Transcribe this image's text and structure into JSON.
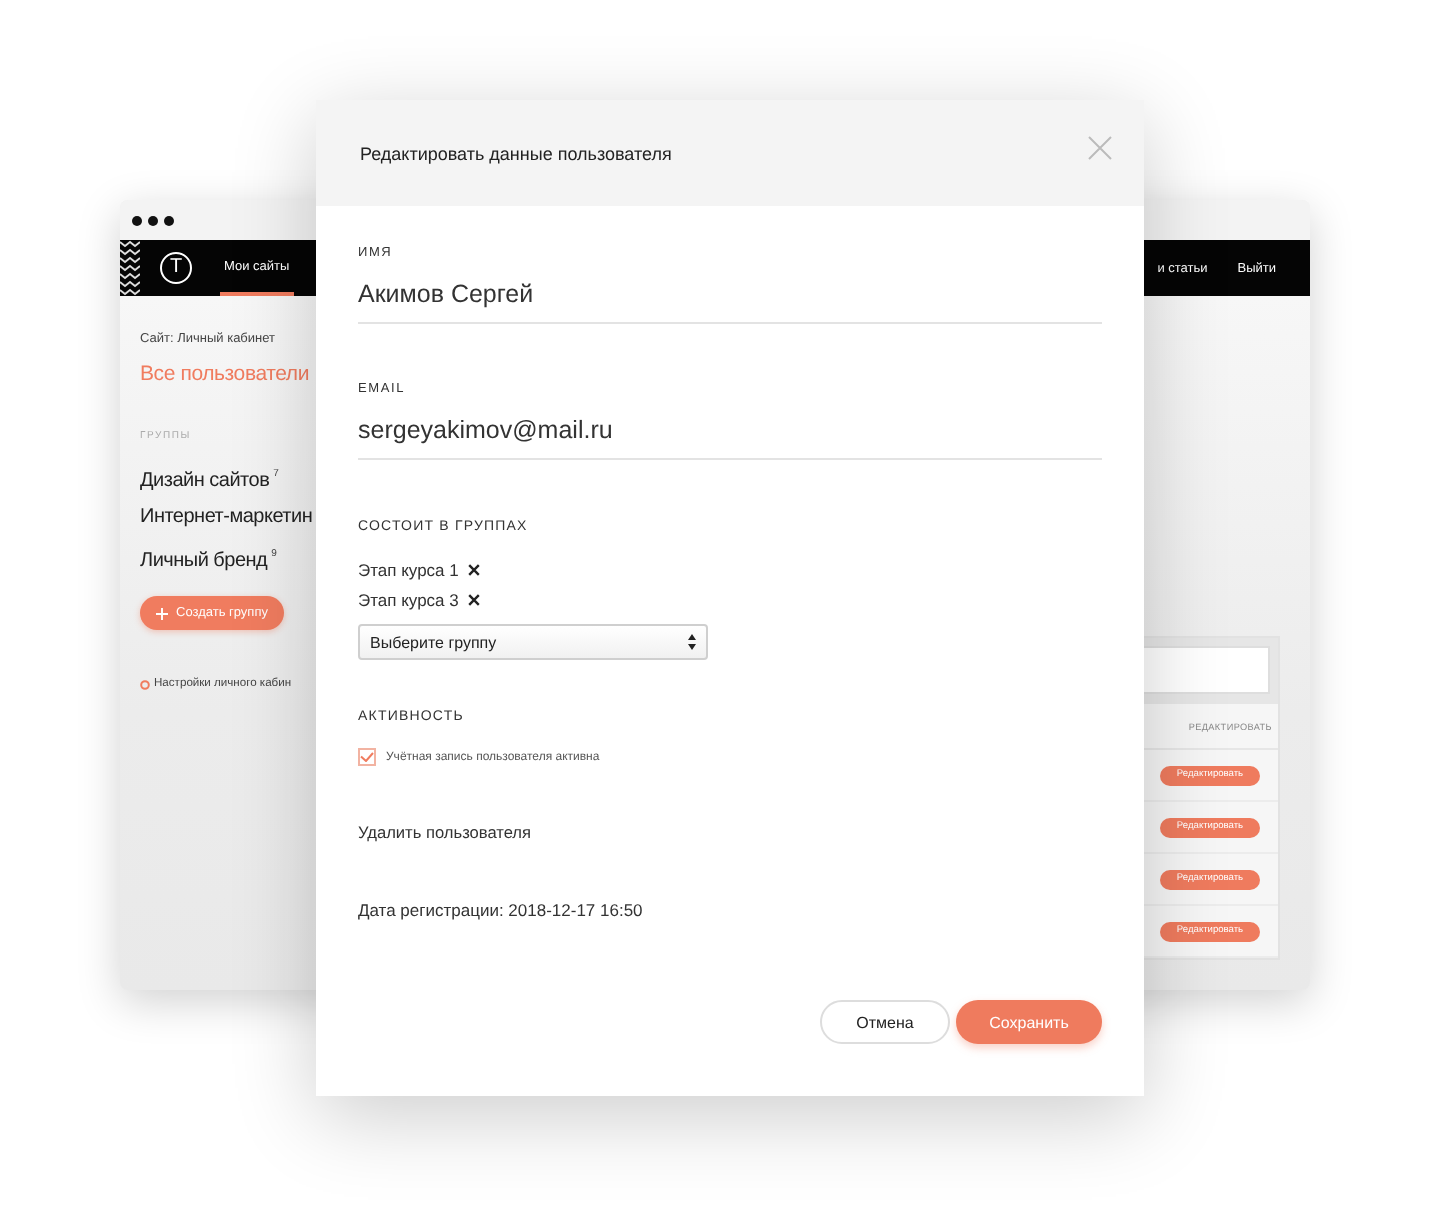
{
  "background_window": {
    "nav": {
      "logo": "T",
      "tabs": [
        {
          "label": "Мои сайты",
          "selected": true
        }
      ],
      "links": [
        {
          "label": "и статьи"
        },
        {
          "label": "Выйти"
        }
      ]
    },
    "sidebar": {
      "site_label": "Сайт: Личный кабинет",
      "all_users": "Все пользователи",
      "groups_heading": "ГРУППЫ",
      "groups": [
        {
          "name": "Дизайн сайтов",
          "count": "7"
        },
        {
          "name": "Интернет-маркетин"
        },
        {
          "name": "Личный бренд",
          "count": "9"
        }
      ],
      "create_button": "Создать группу",
      "settings_link": "Настройки личного кабин"
    },
    "users_table": {
      "columns": [
        "РЕДАКТИРОВАТЬ"
      ],
      "rows": [
        {
          "edit_button": "Редактировать"
        },
        {
          "edit_button": "Редактировать"
        },
        {
          "edit_button": "Редактировать"
        },
        {
          "edit_button": "Редактировать"
        }
      ]
    }
  },
  "modal": {
    "title": "Редактировать данные пользователя",
    "fields": [
      {
        "label": "ИМЯ",
        "value": "Акимов Сергей"
      },
      {
        "label": "EMAIL",
        "value": "sergeyakimov@mail.ru"
      }
    ],
    "groups_section": {
      "heading": "СОСТОИТ В ГРУППАХ",
      "groups": [
        "Этап курса 1",
        "Этап курса 3"
      ],
      "select": {
        "value": "Выберите группу"
      }
    },
    "activity": {
      "heading": "АКТИВНОСТЬ",
      "checkbox": {
        "label": "Учётная запись пользователя активна",
        "checked": true
      }
    },
    "delete_link": "Удалить пользователя",
    "registration": "Дата регистрации: 2018-12-17 16:50",
    "buttons": [
      {
        "label": "Отмена",
        "kind": "secondary"
      },
      {
        "label": "Сохранить",
        "kind": "primary"
      }
    ]
  }
}
